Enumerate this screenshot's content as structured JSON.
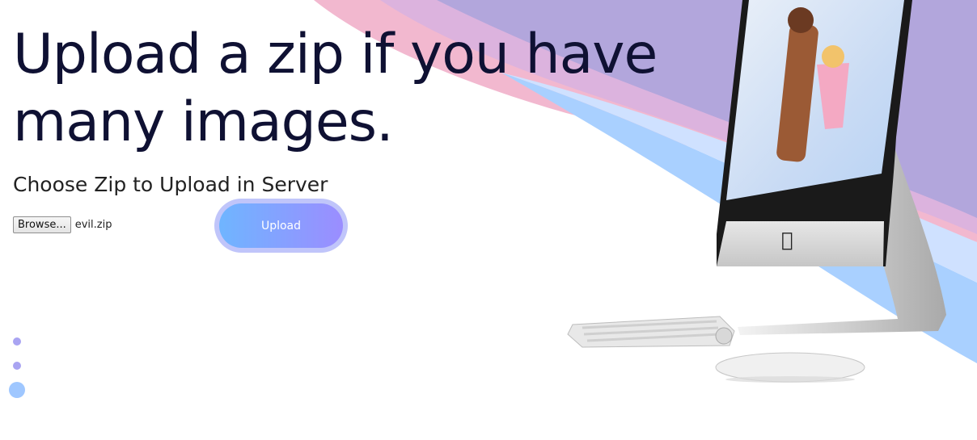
{
  "hero": {
    "title_line1": "Upload a zip if you have",
    "title_line2": "many images."
  },
  "form": {
    "heading": "Choose Zip to Upload in Server",
    "browse_label": "Browse...",
    "selected_file": "evil.zip",
    "upload_label": "Upload"
  },
  "decor": {
    "dots": [
      "dot-small",
      "dot-small",
      "dot-large"
    ],
    "illustration": "desktop-computer-with-keyboard-and-mouse"
  },
  "colors": {
    "title": "#0f1133",
    "button_gradient_start": "#6fb5ff",
    "button_gradient_end": "#9b8dff",
    "bg_purple": "#b2a6dc",
    "bg_pink": "#f2b8cf",
    "bg_blue": "#a9d0ff"
  }
}
